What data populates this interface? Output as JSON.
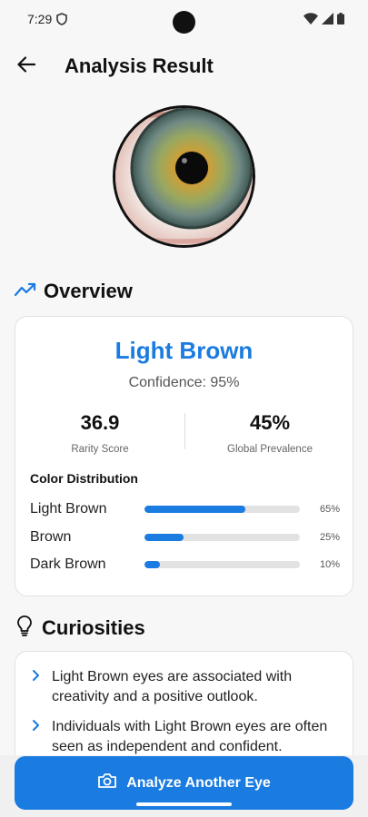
{
  "status_bar": {
    "time": "7:29"
  },
  "header": {
    "title": "Analysis Result"
  },
  "overview": {
    "section_title": "Overview",
    "color_name": "Light Brown",
    "confidence": "Confidence: 95%",
    "stats": [
      {
        "value": "36.9",
        "label": "Rarity Score"
      },
      {
        "value": "45%",
        "label": "Global Prevalence"
      }
    ],
    "distribution_title": "Color Distribution",
    "distribution": [
      {
        "label": "Light Brown",
        "percent": 65,
        "percent_text": "65%"
      },
      {
        "label": "Brown",
        "percent": 25,
        "percent_text": "25%"
      },
      {
        "label": "Dark Brown",
        "percent": 10,
        "percent_text": "10%"
      }
    ]
  },
  "curiosities": {
    "section_title": "Curiosities",
    "items": [
      "Light Brown eyes are associated with creativity and a positive outlook.",
      "Individuals with Light Brown eyes are often seen as independent and confident."
    ]
  },
  "action": {
    "label": "Analyze Another Eye"
  },
  "colors": {
    "accent": "#1a7be0",
    "track": "#e2e2e2",
    "background": "#f7f7f7"
  }
}
